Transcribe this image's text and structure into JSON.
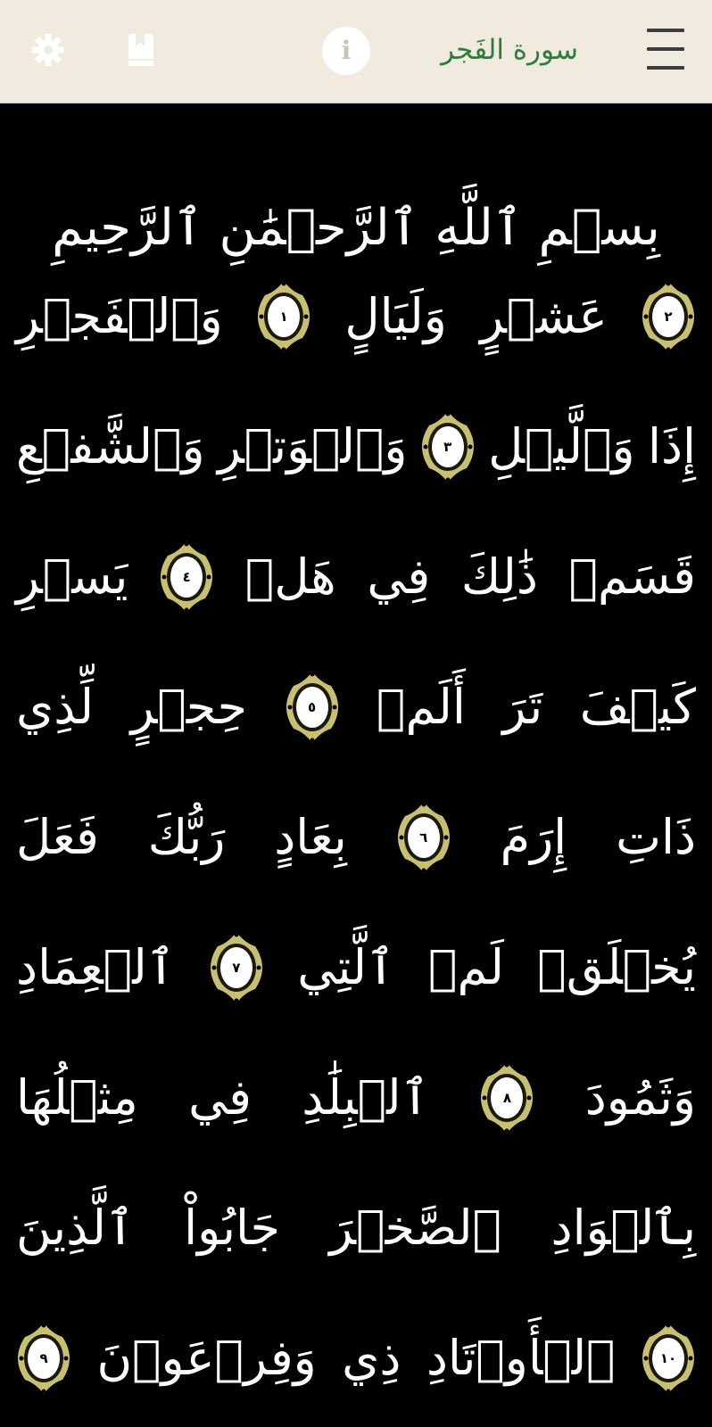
{
  "header": {
    "title": "سورة الفَجر",
    "icons": {
      "settings": "gear-icon",
      "bookmark": "bookmark-icon",
      "info": "info-icon",
      "menu": "hamburger-menu-icon"
    },
    "info_glyph": "i",
    "colors": {
      "header_bg": "#f1ebdf",
      "title": "#2f7d3c",
      "icon": "#ffffff",
      "menu": "#3d3d3d"
    }
  },
  "reader": {
    "background": "#000000",
    "text_color": "#ffffff",
    "marker_color": "#c8c070",
    "basmala": "بِسۡمِ ٱللَّهِ ٱلرَّحۡمَٰنِ ٱلرَّحِيمِ",
    "lines": [
      [
        {
          "t": "word",
          "v": "وَٱلۡفَجۡرِ"
        },
        {
          "t": "ayah",
          "v": "١"
        },
        {
          "t": "word",
          "v": "وَلَيَالٍ"
        },
        {
          "t": "word",
          "v": "عَشۡرٍ"
        },
        {
          "t": "ayah",
          "v": "٢"
        }
      ],
      [
        {
          "t": "word",
          "v": "وَٱلشَّفۡعِ"
        },
        {
          "t": "word",
          "v": "وَٱلۡوَتۡرِ"
        },
        {
          "t": "ayah",
          "v": "٣"
        },
        {
          "t": "word",
          "v": "وَٱلَّيۡلِ"
        },
        {
          "t": "word",
          "v": "إِذَا"
        }
      ],
      [
        {
          "t": "word",
          "v": "يَسۡرِ"
        },
        {
          "t": "ayah",
          "v": "٤"
        },
        {
          "t": "word",
          "v": "هَلۡ"
        },
        {
          "t": "word",
          "v": "فِي"
        },
        {
          "t": "word",
          "v": "ذَٰلِكَ"
        },
        {
          "t": "word",
          "v": "قَسَمٞ"
        }
      ],
      [
        {
          "t": "word",
          "v": "لِّذِي"
        },
        {
          "t": "word",
          "v": "حِجۡرٍ"
        },
        {
          "t": "ayah",
          "v": "٥"
        },
        {
          "t": "word",
          "v": "أَلَمۡ"
        },
        {
          "t": "word",
          "v": "تَرَ"
        },
        {
          "t": "word",
          "v": "كَيۡفَ"
        }
      ],
      [
        {
          "t": "word",
          "v": "فَعَلَ"
        },
        {
          "t": "word",
          "v": "رَبُّكَ"
        },
        {
          "t": "word",
          "v": "بِعَادٍ"
        },
        {
          "t": "ayah",
          "v": "٦"
        },
        {
          "t": "word",
          "v": "إِرَمَ"
        },
        {
          "t": "word",
          "v": "ذَاتِ"
        }
      ],
      [
        {
          "t": "word",
          "v": "ٱلۡعِمَادِ"
        },
        {
          "t": "ayah",
          "v": "٧"
        },
        {
          "t": "word",
          "v": "ٱلَّتِي"
        },
        {
          "t": "word",
          "v": "لَمۡ"
        },
        {
          "t": "word",
          "v": "يُخۡلَقۡ"
        }
      ],
      [
        {
          "t": "word",
          "v": "مِثۡلُهَا"
        },
        {
          "t": "word",
          "v": "فِي"
        },
        {
          "t": "word",
          "v": "ٱلۡبِلَٰدِ"
        },
        {
          "t": "ayah",
          "v": "٨"
        },
        {
          "t": "word",
          "v": "وَثَمُودَ"
        }
      ],
      [
        {
          "t": "word",
          "v": "ٱلَّذِينَ"
        },
        {
          "t": "word",
          "v": "جَابُواْ"
        },
        {
          "t": "word",
          "v": "ٱلصَّخۡرَ"
        },
        {
          "t": "word",
          "v": "بِٱلۡوَادِ"
        }
      ],
      [
        {
          "t": "ayah",
          "v": "٩"
        },
        {
          "t": "word",
          "v": "وَفِرۡعَوۡنَ"
        },
        {
          "t": "word",
          "v": "ذِي"
        },
        {
          "t": "word",
          "v": "ٱلۡأَوۡتَادِ"
        },
        {
          "t": "ayah",
          "v": "١٠"
        }
      ]
    ]
  }
}
